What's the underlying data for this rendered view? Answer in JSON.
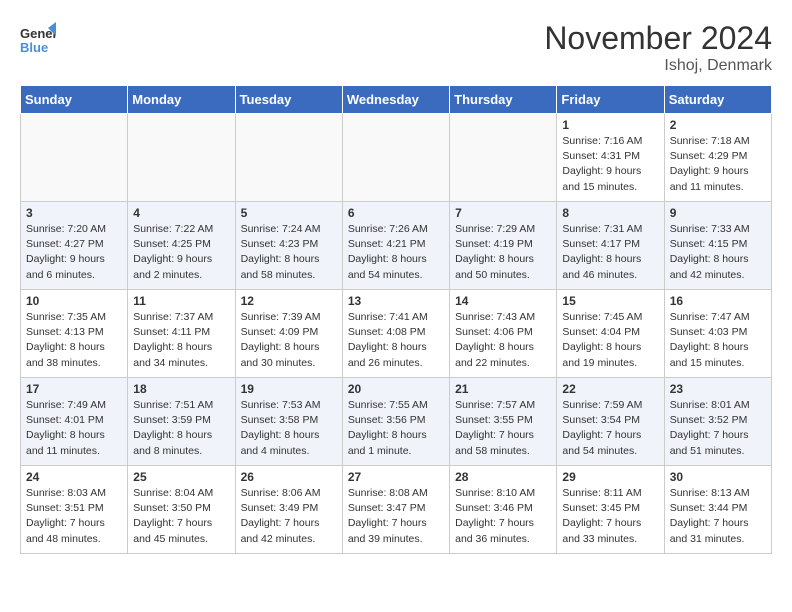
{
  "header": {
    "logo_line1": "General",
    "logo_line2": "Blue",
    "month": "November 2024",
    "location": "Ishoj, Denmark"
  },
  "weekdays": [
    "Sunday",
    "Monday",
    "Tuesday",
    "Wednesday",
    "Thursday",
    "Friday",
    "Saturday"
  ],
  "weeks": [
    [
      {
        "day": "",
        "info": ""
      },
      {
        "day": "",
        "info": ""
      },
      {
        "day": "",
        "info": ""
      },
      {
        "day": "",
        "info": ""
      },
      {
        "day": "",
        "info": ""
      },
      {
        "day": "1",
        "info": "Sunrise: 7:16 AM\nSunset: 4:31 PM\nDaylight: 9 hours\nand 15 minutes."
      },
      {
        "day": "2",
        "info": "Sunrise: 7:18 AM\nSunset: 4:29 PM\nDaylight: 9 hours\nand 11 minutes."
      }
    ],
    [
      {
        "day": "3",
        "info": "Sunrise: 7:20 AM\nSunset: 4:27 PM\nDaylight: 9 hours\nand 6 minutes."
      },
      {
        "day": "4",
        "info": "Sunrise: 7:22 AM\nSunset: 4:25 PM\nDaylight: 9 hours\nand 2 minutes."
      },
      {
        "day": "5",
        "info": "Sunrise: 7:24 AM\nSunset: 4:23 PM\nDaylight: 8 hours\nand 58 minutes."
      },
      {
        "day": "6",
        "info": "Sunrise: 7:26 AM\nSunset: 4:21 PM\nDaylight: 8 hours\nand 54 minutes."
      },
      {
        "day": "7",
        "info": "Sunrise: 7:29 AM\nSunset: 4:19 PM\nDaylight: 8 hours\nand 50 minutes."
      },
      {
        "day": "8",
        "info": "Sunrise: 7:31 AM\nSunset: 4:17 PM\nDaylight: 8 hours\nand 46 minutes."
      },
      {
        "day": "9",
        "info": "Sunrise: 7:33 AM\nSunset: 4:15 PM\nDaylight: 8 hours\nand 42 minutes."
      }
    ],
    [
      {
        "day": "10",
        "info": "Sunrise: 7:35 AM\nSunset: 4:13 PM\nDaylight: 8 hours\nand 38 minutes."
      },
      {
        "day": "11",
        "info": "Sunrise: 7:37 AM\nSunset: 4:11 PM\nDaylight: 8 hours\nand 34 minutes."
      },
      {
        "day": "12",
        "info": "Sunrise: 7:39 AM\nSunset: 4:09 PM\nDaylight: 8 hours\nand 30 minutes."
      },
      {
        "day": "13",
        "info": "Sunrise: 7:41 AM\nSunset: 4:08 PM\nDaylight: 8 hours\nand 26 minutes."
      },
      {
        "day": "14",
        "info": "Sunrise: 7:43 AM\nSunset: 4:06 PM\nDaylight: 8 hours\nand 22 minutes."
      },
      {
        "day": "15",
        "info": "Sunrise: 7:45 AM\nSunset: 4:04 PM\nDaylight: 8 hours\nand 19 minutes."
      },
      {
        "day": "16",
        "info": "Sunrise: 7:47 AM\nSunset: 4:03 PM\nDaylight: 8 hours\nand 15 minutes."
      }
    ],
    [
      {
        "day": "17",
        "info": "Sunrise: 7:49 AM\nSunset: 4:01 PM\nDaylight: 8 hours\nand 11 minutes."
      },
      {
        "day": "18",
        "info": "Sunrise: 7:51 AM\nSunset: 3:59 PM\nDaylight: 8 hours\nand 8 minutes."
      },
      {
        "day": "19",
        "info": "Sunrise: 7:53 AM\nSunset: 3:58 PM\nDaylight: 8 hours\nand 4 minutes."
      },
      {
        "day": "20",
        "info": "Sunrise: 7:55 AM\nSunset: 3:56 PM\nDaylight: 8 hours\nand 1 minute."
      },
      {
        "day": "21",
        "info": "Sunrise: 7:57 AM\nSunset: 3:55 PM\nDaylight: 7 hours\nand 58 minutes."
      },
      {
        "day": "22",
        "info": "Sunrise: 7:59 AM\nSunset: 3:54 PM\nDaylight: 7 hours\nand 54 minutes."
      },
      {
        "day": "23",
        "info": "Sunrise: 8:01 AM\nSunset: 3:52 PM\nDaylight: 7 hours\nand 51 minutes."
      }
    ],
    [
      {
        "day": "24",
        "info": "Sunrise: 8:03 AM\nSunset: 3:51 PM\nDaylight: 7 hours\nand 48 minutes."
      },
      {
        "day": "25",
        "info": "Sunrise: 8:04 AM\nSunset: 3:50 PM\nDaylight: 7 hours\nand 45 minutes."
      },
      {
        "day": "26",
        "info": "Sunrise: 8:06 AM\nSunset: 3:49 PM\nDaylight: 7 hours\nand 42 minutes."
      },
      {
        "day": "27",
        "info": "Sunrise: 8:08 AM\nSunset: 3:47 PM\nDaylight: 7 hours\nand 39 minutes."
      },
      {
        "day": "28",
        "info": "Sunrise: 8:10 AM\nSunset: 3:46 PM\nDaylight: 7 hours\nand 36 minutes."
      },
      {
        "day": "29",
        "info": "Sunrise: 8:11 AM\nSunset: 3:45 PM\nDaylight: 7 hours\nand 33 minutes."
      },
      {
        "day": "30",
        "info": "Sunrise: 8:13 AM\nSunset: 3:44 PM\nDaylight: 7 hours\nand 31 minutes."
      }
    ]
  ]
}
